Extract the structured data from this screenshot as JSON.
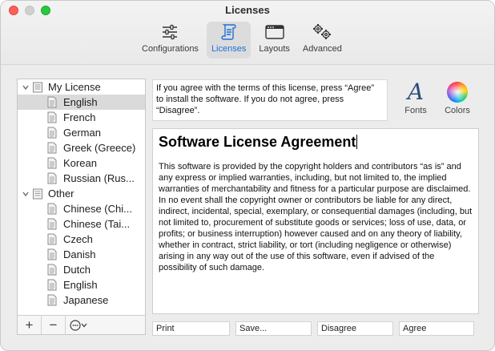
{
  "window": {
    "title": "Licenses"
  },
  "toolbar": {
    "items": [
      {
        "label": "Configurations",
        "icon": "sliders-icon"
      },
      {
        "label": "Licenses",
        "icon": "scroll-icon"
      },
      {
        "label": "Layouts",
        "icon": "window-layout-icon"
      },
      {
        "label": "Advanced",
        "icon": "gears-icon"
      }
    ],
    "active_index": 1
  },
  "sidebar": {
    "groups": [
      {
        "label": "My License",
        "items": [
          "English",
          "French",
          "German",
          "Greek (Greece)",
          "Korean",
          "Russian (Rus..."
        ]
      },
      {
        "label": "Other",
        "items": [
          "Chinese (Chi...",
          "Chinese (Tai...",
          "Czech",
          "Danish",
          "Dutch",
          "English",
          "Japanese"
        ]
      }
    ],
    "selected": "English",
    "add_label": "+",
    "remove_label": "−",
    "action_label": "⊙⌄"
  },
  "info": {
    "text": "If you agree with the terms of this license, press “Agree” to install the software. If you do not agree, press “Disagree”."
  },
  "fonts": {
    "label": "Fonts",
    "glyph": "A"
  },
  "colors": {
    "label": "Colors"
  },
  "editor": {
    "title": "Software License Agreement",
    "body": "This software is provided by the copyright holders and contributors “as is” and any express or implied warranties, including, but not limited to, the implied warranties of merchantability and fitness for a particular purpose are disclaimed. In no event shall the copyright owner or contributors be liable for any direct, indirect, incidental, special, exemplary, or consequential damages (including, but not limited to, procurement of substitute goods or services; loss of use, data, or profits; or business interruption) however caused and on any theory of liability, whether in contract, strict liability, or tort (including negligence or otherwise) arising in any way out of the use of this software, even if advised of the possibility of such damage."
  },
  "buttons": {
    "print": "Print",
    "save": "Save...",
    "disagree": "Disagree",
    "agree": "Agree"
  },
  "colors_theme": {
    "accent": "#1f6fd8",
    "selection": "#dadada"
  }
}
